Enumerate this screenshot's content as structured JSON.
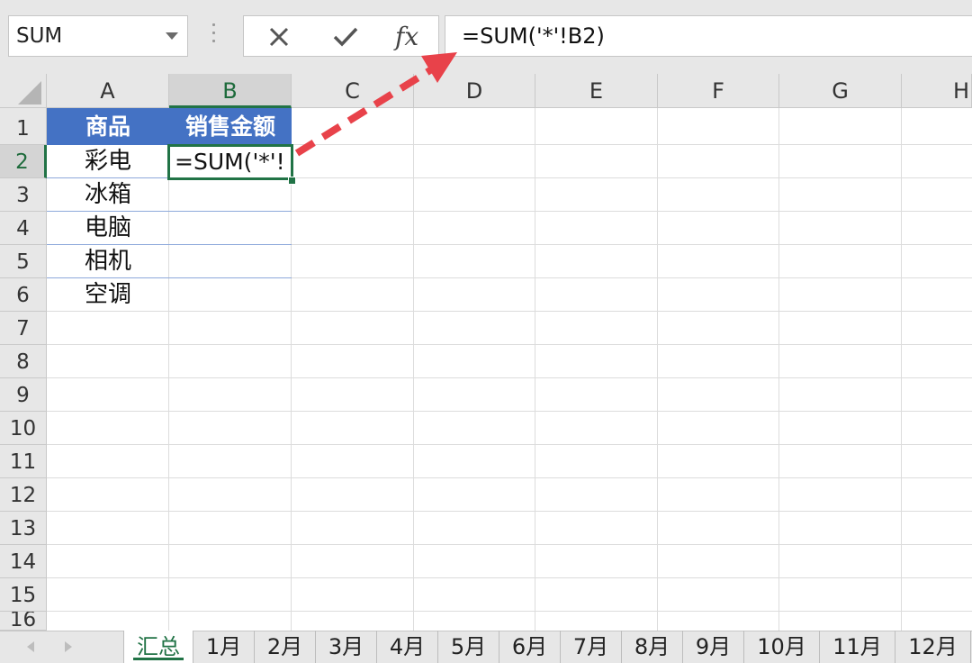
{
  "formula_bar": {
    "name_box": "SUM",
    "cancel_icon": "close-icon",
    "enter_icon": "checkmark-icon",
    "fx_label": "fx",
    "formula": "=SUM('*'!B2)"
  },
  "columns": [
    "A",
    "B",
    "C",
    "D",
    "E",
    "F",
    "G",
    "H"
  ],
  "rows": [
    "1",
    "2",
    "3",
    "4",
    "5",
    "6",
    "7",
    "8",
    "9",
    "10",
    "11",
    "12",
    "13",
    "14",
    "15",
    "16"
  ],
  "selection": {
    "column": "B",
    "row": "2"
  },
  "table": {
    "headers": [
      "商品",
      "销售金额"
    ],
    "items": [
      "彩电",
      "冰箱",
      "电脑",
      "相机",
      "空调"
    ],
    "editing_text": "=SUM('*'!"
  },
  "annotation": {
    "arrow_color": "#e8424a",
    "arrow": "dashed-arrow"
  },
  "colors": {
    "header_fill": "#4472c4",
    "accent_green": "#217346"
  },
  "sheet_tabs": [
    "汇总",
    "1月",
    "2月",
    "3月",
    "4月",
    "5月",
    "6月",
    "7月",
    "8月",
    "9月",
    "10月",
    "11月",
    "12月"
  ],
  "active_tab": "汇总"
}
